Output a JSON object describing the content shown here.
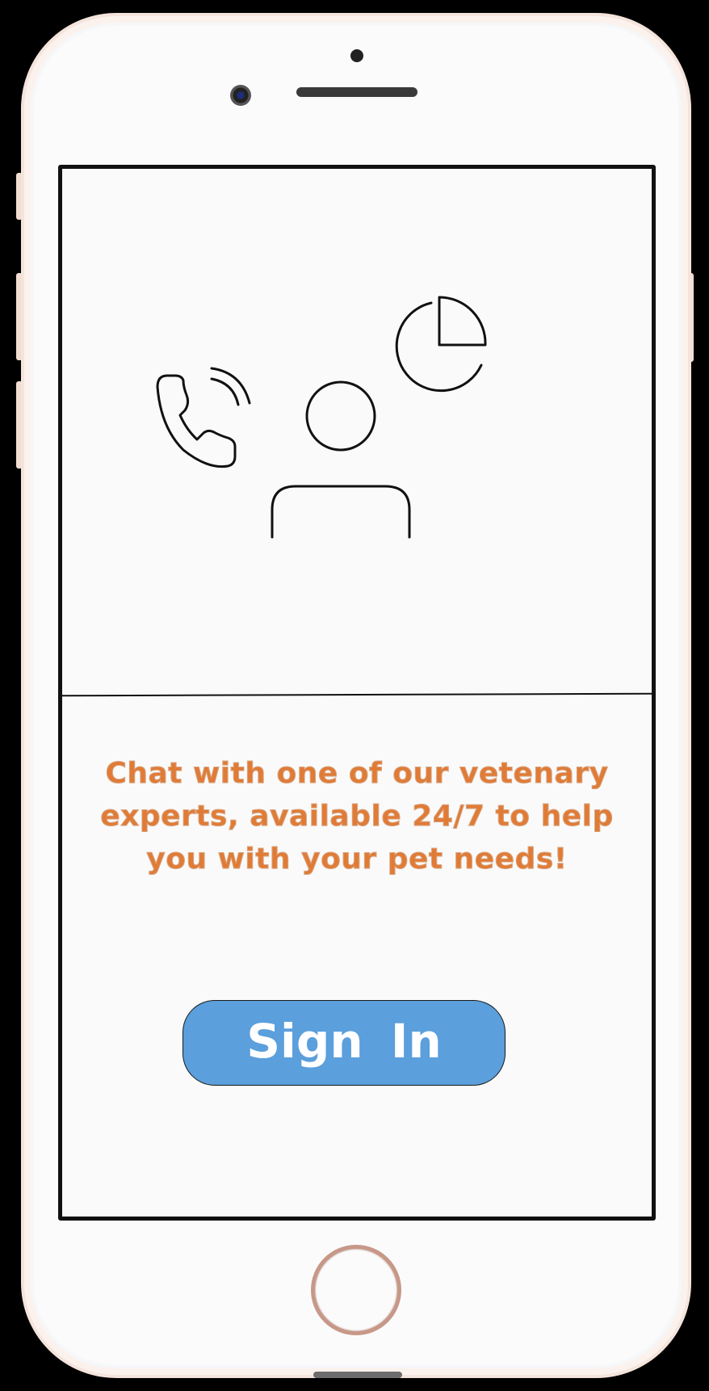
{
  "app": {
    "message": "Chat with one of our vetenary experts, available 24/7 to help you with your pet needs!",
    "sign_in_label": "Sign  In"
  },
  "colors": {
    "message_text": "#e07b36",
    "sign_in_button": "#5b9fdc",
    "screen_background": "#fafafa",
    "device_frame": "#f4e4dc"
  },
  "icons": [
    "phone-call-icon",
    "user-icon",
    "pie-chart-icon"
  ]
}
